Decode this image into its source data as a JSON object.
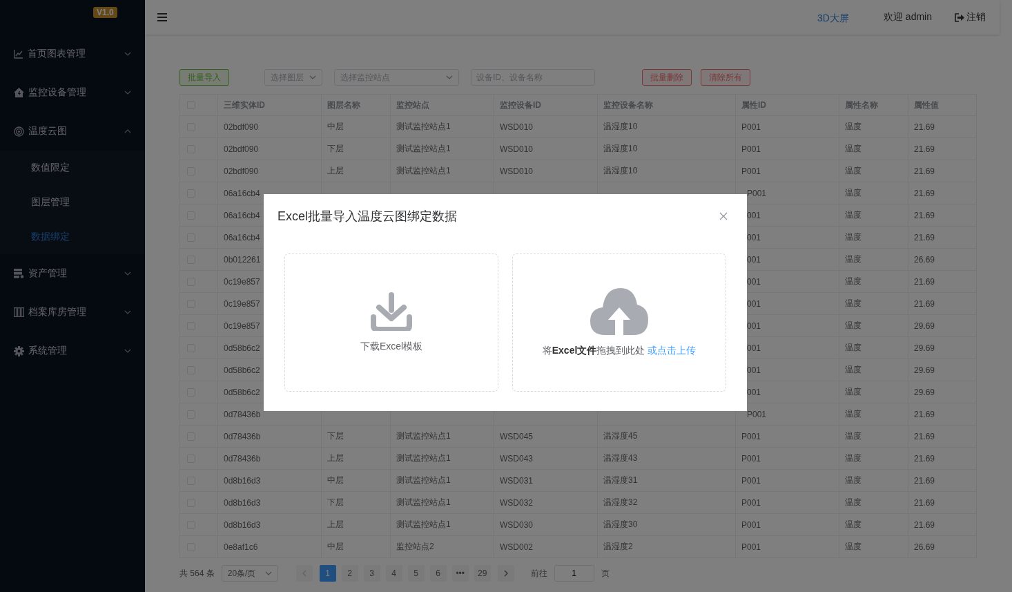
{
  "sidebar": {
    "badge": "V1.0",
    "items": [
      {
        "label": "首页图表管理",
        "expanded": false
      },
      {
        "label": "监控设备管理",
        "expanded": false
      },
      {
        "label": "温度云图",
        "expanded": true,
        "children": [
          {
            "label": "数值限定",
            "selected": false
          },
          {
            "label": "图层管理",
            "selected": false
          },
          {
            "label": "数据绑定",
            "selected": true
          }
        ]
      },
      {
        "label": "资产管理",
        "expanded": false
      },
      {
        "label": "档案库房管理",
        "expanded": false
      },
      {
        "label": "系统管理",
        "expanded": false
      }
    ]
  },
  "header": {
    "screen_link": "3D大屏",
    "welcome": "欢迎 admin",
    "logout": "注销"
  },
  "toolbar": {
    "import_button": "批量导入",
    "layer_select": {
      "placeholder": "选择图层"
    },
    "station_select": {
      "placeholder": "选择监控站点"
    },
    "search": {
      "placeholder": "设备ID、设备名称"
    },
    "delete_button": "批量删除",
    "clear_button": "清除所有"
  },
  "table": {
    "header_checked": false,
    "columns": [
      "三维实体ID",
      "图层名称",
      "监控站点",
      "监控设备ID",
      "监控设备名称",
      "属性ID",
      "属性名称",
      "属性值"
    ],
    "rows": [
      {
        "checked": false,
        "entity_id": "02bdf090",
        "layer": "中层",
        "station": "测试监控站点1",
        "device_id": "WSD010",
        "device_name": "温湿度10",
        "property_id": "P001",
        "property_name": "温度",
        "value": "21.69"
      },
      {
        "checked": false,
        "entity_id": "02bdf090",
        "layer": "下层",
        "station": "测试监控站点1",
        "device_id": "WSD010",
        "device_name": "温湿度10",
        "property_id": "P001",
        "property_name": "温度",
        "value": "21.69"
      },
      {
        "checked": false,
        "entity_id": "02bdf090",
        "layer": "上层",
        "station": "测试监控站点1",
        "device_id": "WSD010",
        "device_name": "温湿度10",
        "property_id": "P001",
        "property_name": "温度",
        "value": "21.69"
      },
      {
        "checked": false,
        "entity_id": "06a16cb4",
        "property_id": "P001",
        "property_name": "温度",
        "value": "21.69"
      },
      {
        "checked": false,
        "entity_id": "06a16cb4",
        "property_id": "001",
        "property_name": "温度",
        "value": "21.69"
      },
      {
        "checked": false,
        "entity_id": "06a16cb4",
        "property_id": "001",
        "property_name": "温度",
        "value": "21.69"
      },
      {
        "checked": false,
        "entity_id": "0b012261",
        "property_id": "001",
        "property_name": "温度",
        "value": "26.69"
      },
      {
        "checked": false,
        "entity_id": "0c19e857",
        "property_id": "001",
        "property_name": "温度",
        "value": "21.69"
      },
      {
        "checked": false,
        "entity_id": "0c19e857",
        "property_id": "001",
        "property_name": "温度",
        "value": "21.69"
      },
      {
        "checked": false,
        "entity_id": "0c19e857",
        "property_id": "001",
        "property_name": "温度",
        "value": "29.69"
      },
      {
        "checked": false,
        "entity_id": "0d58b6c2",
        "property_id": "001",
        "property_name": "温度",
        "value": "29.69"
      },
      {
        "checked": false,
        "entity_id": "0d58b6c2",
        "property_id": "001",
        "property_name": "温度",
        "value": "29.69"
      },
      {
        "checked": false,
        "entity_id": "0d58b6c2",
        "property_id": "001",
        "property_name": "温度",
        "value": "29.69"
      },
      {
        "checked": false,
        "entity_id": "0d78436b",
        "property_id": "P001",
        "property_name": "温度",
        "value": "21.69"
      },
      {
        "checked": false,
        "entity_id": "0d78436b",
        "layer": "下层",
        "station": "测试监控站点1",
        "device_id": "WSD045",
        "device_name": "温湿度45",
        "property_id": "P001",
        "property_name": "温度",
        "value": "21.69"
      },
      {
        "checked": false,
        "entity_id": "0d78436b",
        "layer": "上层",
        "station": "测试监控站点1",
        "device_id": "WSD043",
        "device_name": "温湿度43",
        "property_id": "P001",
        "property_name": "温度",
        "value": "21.69"
      },
      {
        "checked": false,
        "entity_id": "0d8b16d3",
        "layer": "中层",
        "station": "测试监控站点1",
        "device_id": "WSD031",
        "device_name": "温湿度31",
        "property_id": "P001",
        "property_name": "温度",
        "value": "21.69"
      },
      {
        "checked": false,
        "entity_id": "0d8b16d3",
        "layer": "下层",
        "station": "测试监控站点1",
        "device_id": "WSD032",
        "device_name": "温湿度32",
        "property_id": "P001",
        "property_name": "温度",
        "value": "21.69"
      },
      {
        "checked": false,
        "entity_id": "0d8b16d3",
        "layer": "上层",
        "station": "测试监控站点1",
        "device_id": "WSD030",
        "device_name": "温湿度30",
        "property_id": "P001",
        "property_name": "温度",
        "value": "21.69"
      },
      {
        "checked": false,
        "entity_id": "0e8af1c6",
        "layer": "中层",
        "station": "监控站点2",
        "device_id": "WSD002",
        "device_name": "温湿度2",
        "property_id": "P001",
        "property_name": "温度",
        "value": "26.69"
      }
    ]
  },
  "pagination": {
    "total": "共 564 条",
    "page_size": "20条/页",
    "prev_disabled": true,
    "next_disabled": false,
    "pages": [
      {
        "label": "1",
        "selected": true
      },
      {
        "label": "2",
        "selected": false
      },
      {
        "label": "3",
        "selected": false
      },
      {
        "label": "4",
        "selected": false
      },
      {
        "label": "5",
        "selected": false
      },
      {
        "label": "6",
        "selected": false
      },
      {
        "label": "•••",
        "selected": false
      },
      {
        "label": "29",
        "selected": false
      }
    ],
    "goto_label": "前往",
    "goto_value": "1",
    "goto_suffix": "页"
  },
  "modal": {
    "title": "Excel批量导入温度云图绑定数据",
    "download_label": "下载Excel模板",
    "upload_text": "将**Excel文件**拖拽到此处",
    "upload_link": "或点击上传"
  }
}
